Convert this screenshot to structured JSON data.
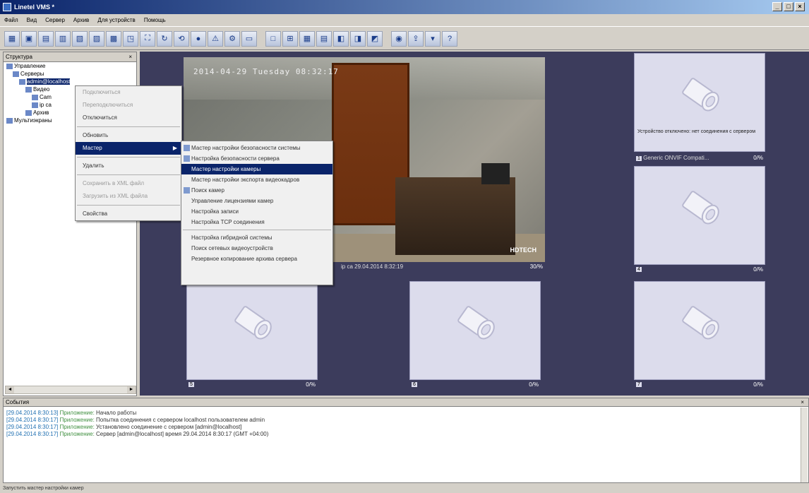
{
  "window": {
    "title": "Linetel VMS *",
    "controls": [
      "_",
      "□",
      "×"
    ]
  },
  "menubar": [
    "Файл",
    "Вид",
    "Сервер",
    "Архив",
    "Для устройств",
    "Помощь"
  ],
  "toolbar": {
    "icons": [
      "layout-icon",
      "save-icon",
      "grid-1-icon",
      "grid-2-icon",
      "grid-3-icon",
      "grid-4-icon",
      "grid-5-icon",
      "grid-6-icon",
      "fullscreen-icon",
      "ptz-icon",
      "rotate-icon",
      "record-icon",
      "alarm-icon",
      "settings-icon",
      "monitor-icon",
      "layout-1x1-icon",
      "layout-2x2-icon",
      "layout-3x3-icon",
      "layout-4x4-icon",
      "layout-1p5-icon",
      "layout-1p7-icon",
      "layout-1p12-icon",
      "snapshot-icon",
      "export-icon",
      "archive-icon",
      "help-icon"
    ]
  },
  "tree_panel": {
    "title": "Структура",
    "close": "×",
    "items": [
      {
        "label": "Управление",
        "indent": 0
      },
      {
        "label": "Серверы",
        "indent": 1
      },
      {
        "label": "admin@localhost",
        "indent": 2,
        "selected": true
      },
      {
        "label": "Видео",
        "indent": 3
      },
      {
        "label": "Cam",
        "indent": 4
      },
      {
        "label": "ip ca",
        "indent": 4
      },
      {
        "label": "Архив",
        "indent": 3
      },
      {
        "label": "Мультиэкраны",
        "indent": 0
      }
    ]
  },
  "context_menu": {
    "items": [
      {
        "label": "Подключиться",
        "disabled": true
      },
      {
        "label": "Переподключиться",
        "disabled": true
      },
      {
        "label": "Отключиться",
        "disabled": false
      },
      {
        "sep": true
      },
      {
        "label": "Обновить",
        "disabled": false
      },
      {
        "label": "Мастер",
        "disabled": false,
        "highlighted": true,
        "submenu": true
      },
      {
        "sep": true
      },
      {
        "label": "Удалить",
        "disabled": false
      },
      {
        "sep": true
      },
      {
        "label": "Сохранить в XML файл",
        "disabled": true
      },
      {
        "label": "Загрузить из XML файла",
        "disabled": true
      },
      {
        "sep": true
      },
      {
        "label": "Свойства",
        "disabled": false
      }
    ]
  },
  "submenu": {
    "items": [
      {
        "label": "Мастер настройки безопасности системы",
        "icon": true
      },
      {
        "label": "Настройка безопасности сервера",
        "icon": true
      },
      {
        "label": "Мастер настройки камеры",
        "highlighted": true
      },
      {
        "label": "Мастер настройки экспорта видеокадров"
      },
      {
        "label": "Поиск камер",
        "icon": true
      },
      {
        "label": "Управление лицензиями камер"
      },
      {
        "label": "Настройка записи"
      },
      {
        "label": "Настройка TCP соединения"
      },
      {
        "sep": true
      },
      {
        "label": "Настройка гибридной системы"
      },
      {
        "label": "Поиск сетевых видеоустройств"
      },
      {
        "label": "Резервное копирование архива сервера"
      }
    ]
  },
  "live_camera": {
    "timestamp": "2014-04-29 Tuesday 08:32:17",
    "logo": "HDTECH",
    "bar_label": "ip ca  29.04.2014 8:32:19",
    "bar_fps": "30/%"
  },
  "camera_tiles": [
    {
      "id": "top-right",
      "num": "1",
      "name": "Generic ONVIF Compati...",
      "fps": "0/%",
      "msg": "Устройство отключено: нет соединения с сервером"
    },
    {
      "id": "mid-right",
      "num": "4",
      "name": "",
      "fps": "0/%",
      "msg": ""
    },
    {
      "id": "bottom-left",
      "num": "5",
      "name": "",
      "fps": "0/%",
      "msg": ""
    },
    {
      "id": "bottom-mid",
      "num": "6",
      "name": "",
      "fps": "0/%",
      "msg": ""
    },
    {
      "id": "bottom-right",
      "num": "7",
      "name": "",
      "fps": "0/%",
      "msg": ""
    }
  ],
  "events_panel": {
    "title": "События",
    "close": "×",
    "lines": [
      {
        "time": "[29.04.2014 8:30:13]",
        "src": "Приложение:",
        "msg": "Начало работы"
      },
      {
        "time": "[29.04.2014 8:30:17]",
        "src": "Приложение:",
        "msg": "Попытка соединения с сервером localhost пользователем admin"
      },
      {
        "time": "[29.04.2014 8:30:17]",
        "src": "Приложение:",
        "msg": "Установлено соединение с сервером [admin@localhost]"
      },
      {
        "time": "[29.04.2014 8:30:17]",
        "src": "Приложение:",
        "msg": "Сервер [admin@localhost] время 29.04.2014 8:30:17 (GMT +04:00)"
      }
    ]
  },
  "statusbar": {
    "text": "Запустить мастер настройки камер"
  }
}
